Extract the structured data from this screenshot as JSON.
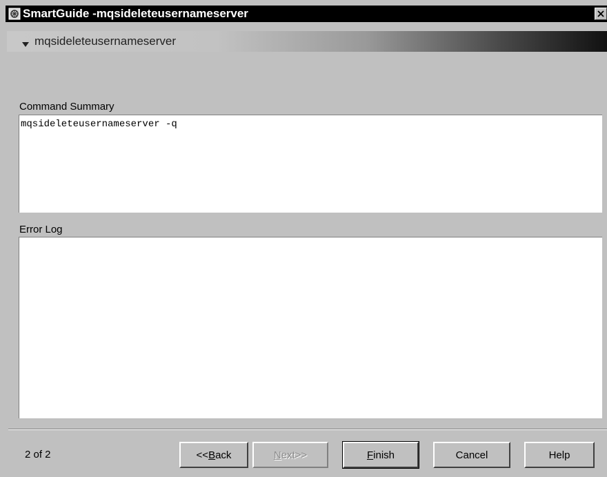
{
  "window": {
    "title": "SmartGuide -mqsideleteusernameserver",
    "icons": {
      "app": "smartguide-icon",
      "close": "close-icon"
    }
  },
  "banner": {
    "title": "mqsideleteusernameserver",
    "icon": "triangle-down-icon"
  },
  "command_summary": {
    "label": "Command Summary",
    "value": "mqsideleteusernameserver -q"
  },
  "error_log": {
    "label": "Error Log",
    "value": ""
  },
  "footer": {
    "page_indicator": "2 of 2",
    "buttons": {
      "back": {
        "prefix": "<<",
        "mnemonic": "B",
        "rest": "ack",
        "enabled": true
      },
      "next": {
        "mnemonic": "N",
        "rest": "ext>>",
        "enabled": false
      },
      "finish": {
        "mnemonic": "F",
        "rest": "inish",
        "enabled": true
      },
      "cancel": {
        "label": "Cancel",
        "enabled": true
      },
      "help": {
        "label": "Help",
        "enabled": true
      }
    }
  }
}
